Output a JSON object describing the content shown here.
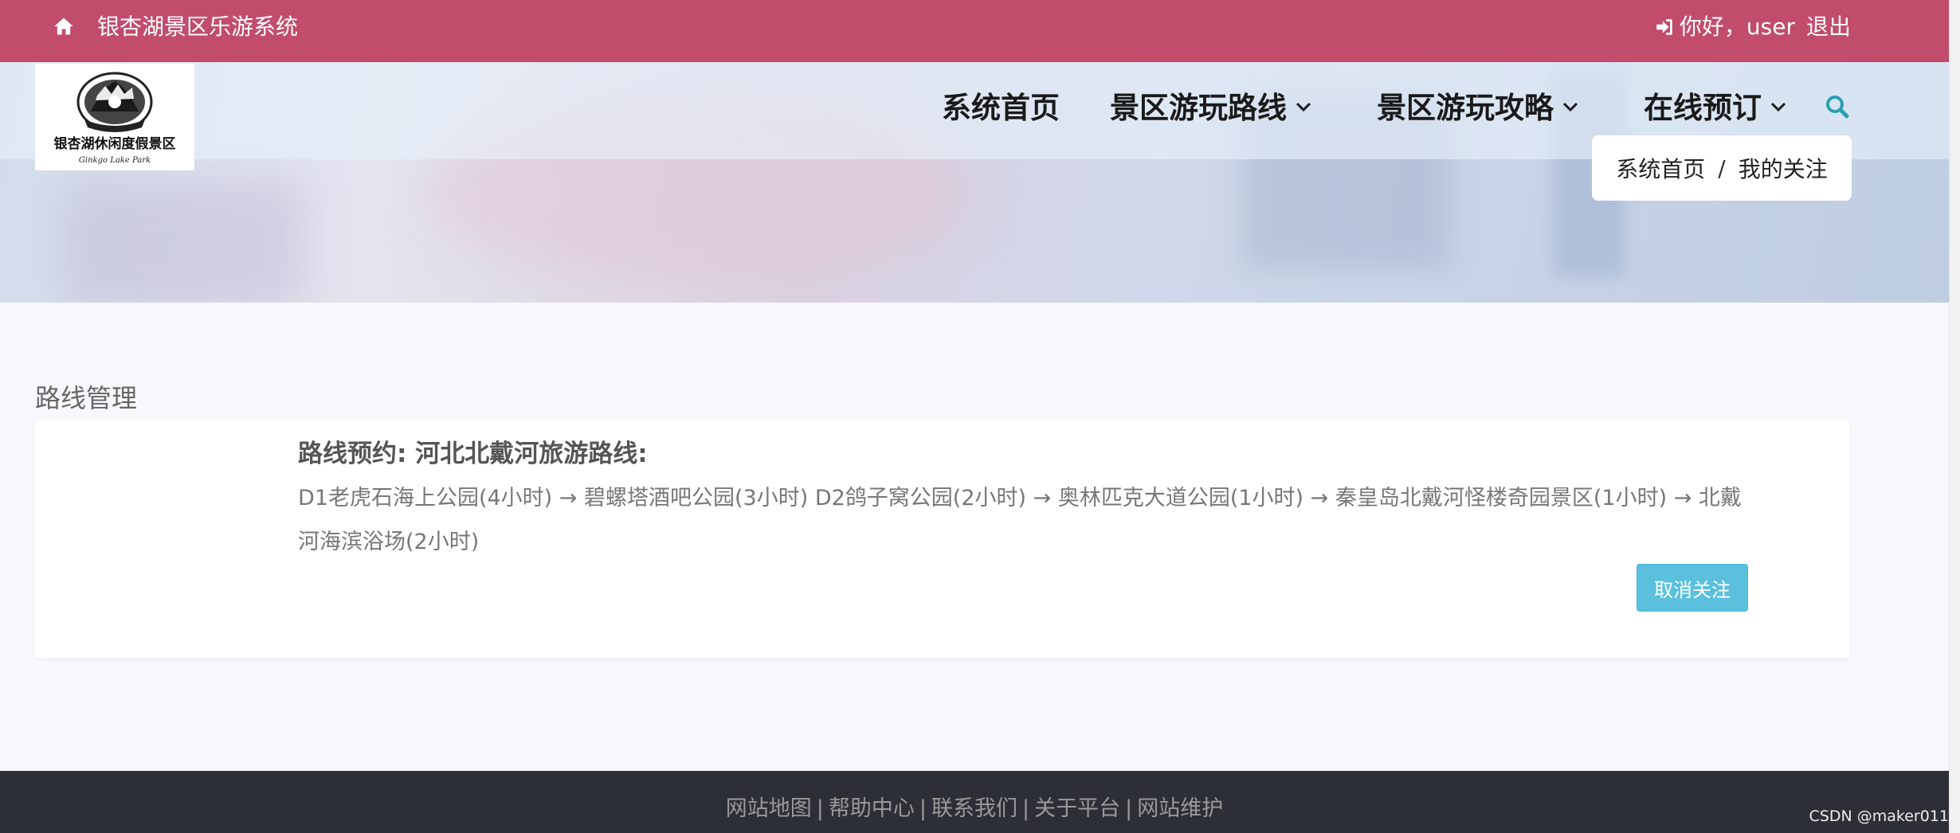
{
  "topbar": {
    "site_title": "银杏湖景区乐游系统",
    "greeting": "你好，user",
    "logout": "退出",
    "home_icon": "home-icon",
    "login_icon": "sign-in-icon",
    "bg_color": "#c14c6c"
  },
  "nav": {
    "items": [
      {
        "label": "系统首页",
        "has_dropdown": false
      },
      {
        "label": "景区游玩路线",
        "has_dropdown": true
      },
      {
        "label": "景区游玩攻略",
        "has_dropdown": true
      },
      {
        "label": "在线预订",
        "has_dropdown": true
      }
    ],
    "search_icon": "search-icon",
    "search_color": "#2a9fb0"
  },
  "logo": {
    "text": "银杏湖休闲度假景区",
    "script": "Ginkgo Lake Park"
  },
  "breadcrumb": {
    "home": "系统首页",
    "separator": "/",
    "current": "我的关注"
  },
  "main": {
    "section_title": "路线管理",
    "card": {
      "title": "路线预约: 河北北戴河旅游路线:",
      "description": "D1老虎石海上公园(4小时) → 碧螺塔酒吧公园(3小时) D2鸽子窝公园(2小时) → 奥林匹克大道公园(1小时) → 秦皇岛北戴河怪楼奇园景区(1小时) → 北戴河海滨浴场(2小时)",
      "button": "取消关注",
      "button_color": "#5bc0de"
    }
  },
  "footer": {
    "links": [
      "网站地图",
      "帮助中心",
      "联系我们",
      "关于平台",
      "网站维护"
    ],
    "separator": "|",
    "bg_color": "#2d2f36"
  },
  "watermark": "CSDN @maker011"
}
